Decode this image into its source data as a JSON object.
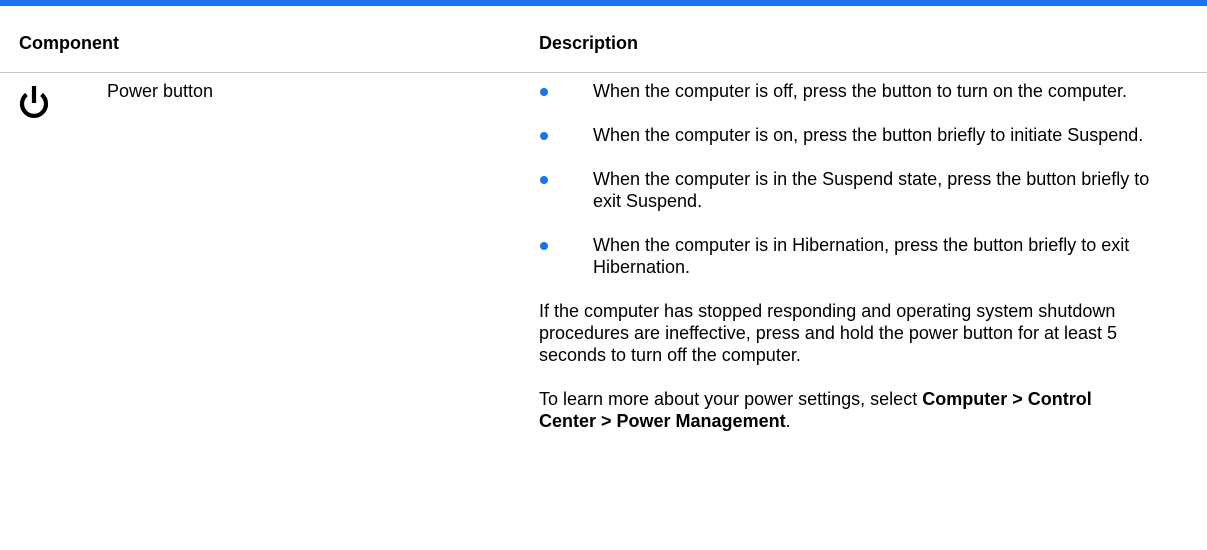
{
  "table": {
    "accent_color": "#1a73e8",
    "header": {
      "component": "Component",
      "description": "Description"
    },
    "row": {
      "icon": "power-icon",
      "component": "Power button",
      "bullets": [
        "When the computer is off, press the button to turn on the computer.",
        "When the computer is on, press the button briefly to initiate Suspend.",
        "When the computer is in the Suspend state, press the button briefly to exit Suspend.",
        "When the computer is in Hibernation, press the button briefly to exit Hibernation."
      ],
      "note": "If the computer has stopped responding and operating system shutdown procedures are ineffective, press and hold the power button for at least 5 seconds to turn off the computer.",
      "settings": {
        "prefix": "To learn more about your power settings, select ",
        "path": "Computer > Control Center  > Power Management",
        "suffix": "."
      }
    }
  }
}
